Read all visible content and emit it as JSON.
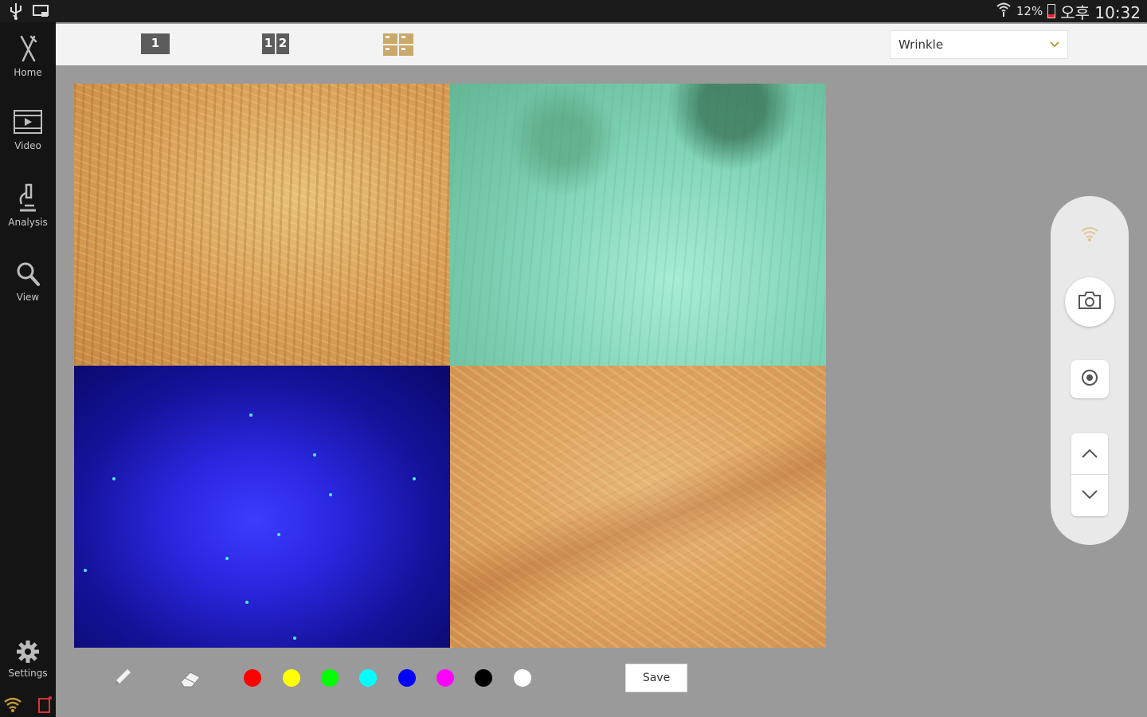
{
  "status_bar": {
    "icons": [
      "usb-icon",
      "screen-cast-icon",
      "wifi-icon",
      "battery-icon"
    ],
    "battery": "12%",
    "time": "오후 10:32"
  },
  "sidebar": {
    "items": [
      {
        "label": "Home",
        "icon": "home-icon"
      },
      {
        "label": "Video",
        "icon": "video-icon"
      },
      {
        "label": "Analysis",
        "icon": "microscope-icon"
      },
      {
        "label": "View",
        "icon": "magnifier-icon"
      }
    ],
    "settings_label": "Settings",
    "bottom_icons": [
      "wifi-icon",
      "device-icon"
    ]
  },
  "toolbar": {
    "layouts": [
      {
        "name": "single-view",
        "labels": [
          "1"
        ]
      },
      {
        "name": "dual-view",
        "labels": [
          "1",
          "2"
        ]
      },
      {
        "name": "quad-view",
        "labels": []
      }
    ],
    "mode_select": {
      "value": "Wrinkle"
    }
  },
  "images": [
    {
      "name": "skin-image-normal-light"
    },
    {
      "name": "skin-image-polarized-light"
    },
    {
      "name": "skin-image-uv-light"
    },
    {
      "name": "skin-image-wrinkle"
    }
  ],
  "drawing_tools": {
    "tools": [
      "pen-icon",
      "eraser-icon"
    ],
    "colors": [
      "#ff0000",
      "#ffff00",
      "#00ff00",
      "#00ffff",
      "#0000ff",
      "#ff00ff",
      "#000000",
      "#ffffff"
    ],
    "save_label": "Save"
  },
  "capture_panel": {
    "icons": [
      "wifi-icon",
      "camera-icon",
      "record-icon",
      "chevron-up-icon",
      "chevron-down-icon"
    ],
    "accent_color": "#c49a3a"
  }
}
